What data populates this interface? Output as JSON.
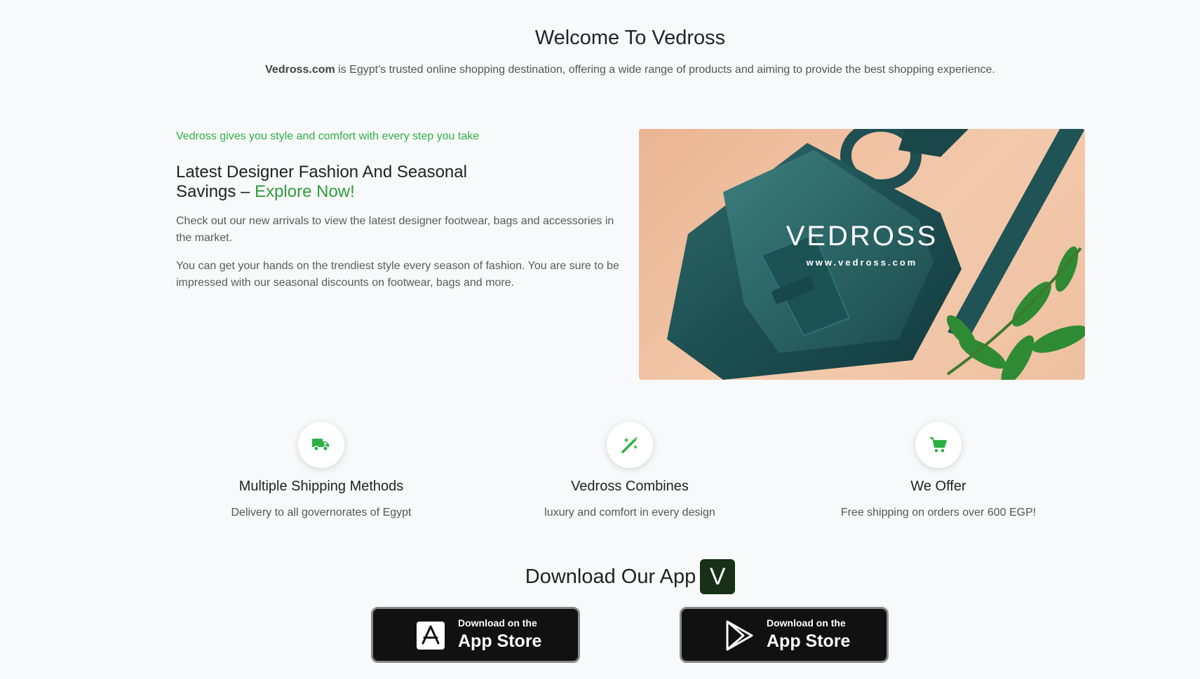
{
  "welcome": {
    "title": "Welcome To Vedross",
    "brand": "Vedross.com",
    "description": " is Egypt's trusted online shopping destination, offering a wide range of products and aiming to provide the best shopping experience."
  },
  "intro": {
    "tagline": "Vedross gives you style and comfort with every step you take",
    "heading": "Latest Designer Fashion And Seasonal Savings – ",
    "heading_accent": "Explore Now!",
    "paragraph1": "Check out our new arrivals to view the latest designer footwear, bags and accessories in the market.",
    "paragraph2": "You can get your hands on the trendiest style every season of fashion. You are sure to be impressed with our seasonal discounts on footwear, bags and more."
  },
  "hero": {
    "logo_text": "VEDROSS",
    "logo_url": "www.vedross.com"
  },
  "features": [
    {
      "icon": "shipping-fast-icon",
      "title": "Multiple Shipping Methods",
      "description": "Delivery to all governorates of Egypt"
    },
    {
      "icon": "magic-wand-icon",
      "title": "Vedross Combines",
      "description": "luxury and comfort in every design"
    },
    {
      "icon": "shopping-cart-icon",
      "title": "We Offer",
      "description": "Free shipping on orders over 600 EGP!"
    }
  ],
  "download": {
    "title": "Download Our App",
    "badge": "V",
    "buttons": [
      {
        "icon": "app-store-icon",
        "small": "Download on the",
        "big": "App Store"
      },
      {
        "icon": "google-play-icon",
        "small": "Download on the",
        "big": "App Store"
      }
    ]
  },
  "colors": {
    "accent_green": "#2db043",
    "badge_dark_green": "#173017",
    "background": "#f8f9fa"
  }
}
